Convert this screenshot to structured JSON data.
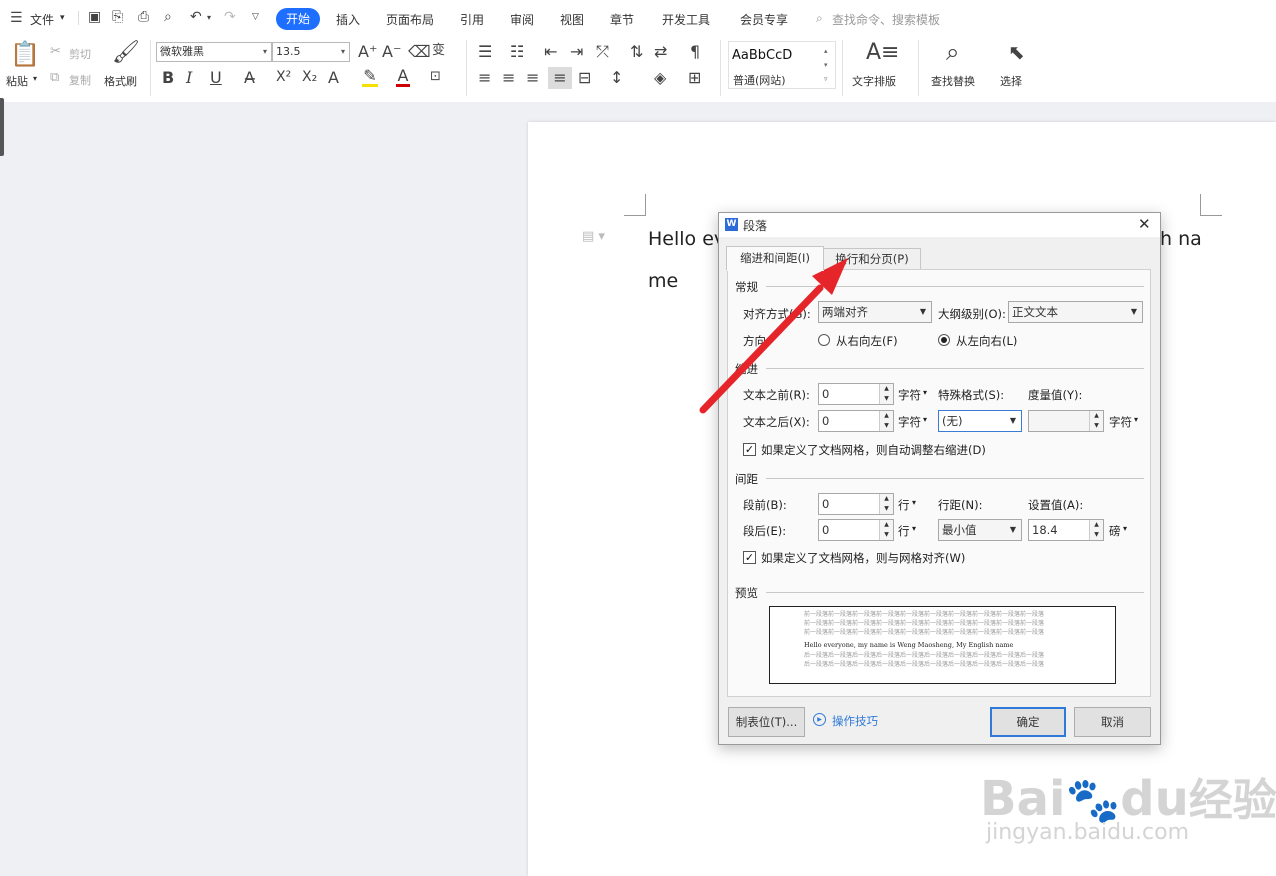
{
  "menubar": {
    "items": [
      "文件",
      "开始",
      "插入",
      "页面布局",
      "引用",
      "审阅",
      "视图",
      "章节",
      "开发工具",
      "会员专享"
    ],
    "search_placeholder": "查找命令、搜索模板"
  },
  "ribbon": {
    "paste": "粘贴",
    "cut": "剪切",
    "copy": "复制",
    "format_painter": "格式刷",
    "font_name": "微软雅黑",
    "font_size": "13.5",
    "style_sample": "AaBbCcD",
    "style_name": "普通(网站)",
    "text_layout": "文字排版",
    "find_replace": "查找替换",
    "select": "选择",
    "accent": "#1e6fff"
  },
  "document": {
    "line1_left": "Hello  ev",
    "line1_right": "h  na",
    "line2": "me"
  },
  "dialog": {
    "title": "段落",
    "tabs": [
      "缩进和间距(I)",
      "换行和分页(P)"
    ],
    "sections": {
      "general": "常规",
      "indent": "缩进",
      "spacing": "间距",
      "preview": "预览"
    },
    "alignment_label": "对齐方式(G):",
    "alignment_value": "两端对齐",
    "outline_label": "大纲级别(O):",
    "outline_value": "正文文本",
    "direction_label": "方向:",
    "rtl": "从右向左(F)",
    "ltr": "从左向右(L)",
    "before_text_label": "文本之前(R):",
    "before_text_value": "0",
    "after_text_label": "文本之后(X):",
    "after_text_value": "0",
    "unit_char": "字符",
    "special_label": "特殊格式(S):",
    "special_value": "(无)",
    "measure_label": "度量值(Y):",
    "measure_value": "",
    "auto_indent_check": "如果定义了文档网格，则自动调整右缩进(D)",
    "space_before_label": "段前(B):",
    "space_before_value": "0",
    "space_after_label": "段后(E):",
    "space_after_value": "0",
    "unit_line": "行",
    "line_spacing_label": "行距(N):",
    "line_spacing_value": "最小值",
    "set_value_label": "设置值(A):",
    "set_value": "18.4",
    "unit_pound": "磅",
    "grid_check": "如果定义了文档网格，则与网格对齐(W)",
    "preview_before": "前一段落前一段落前一段落前一段落前一段落前一段落前一段落前一段落前一段落前一段落",
    "preview_text": "Hello  everyone,  my  name  is  Weng  Maosheng,  My  English  name",
    "preview_after": "后一段落后一段落后一段落后一段落后一段落后一段落后一段落后一段落后一段落后一段落",
    "tabs_button": "制表位(T)...",
    "tips": "操作技巧",
    "ok": "确定",
    "cancel": "取消",
    "arrow_color": "#e5252a"
  },
  "watermark": {
    "brand": "Bai",
    "brand2": "du",
    "cn": "经验",
    "url": "jingyan.baidu.com"
  }
}
